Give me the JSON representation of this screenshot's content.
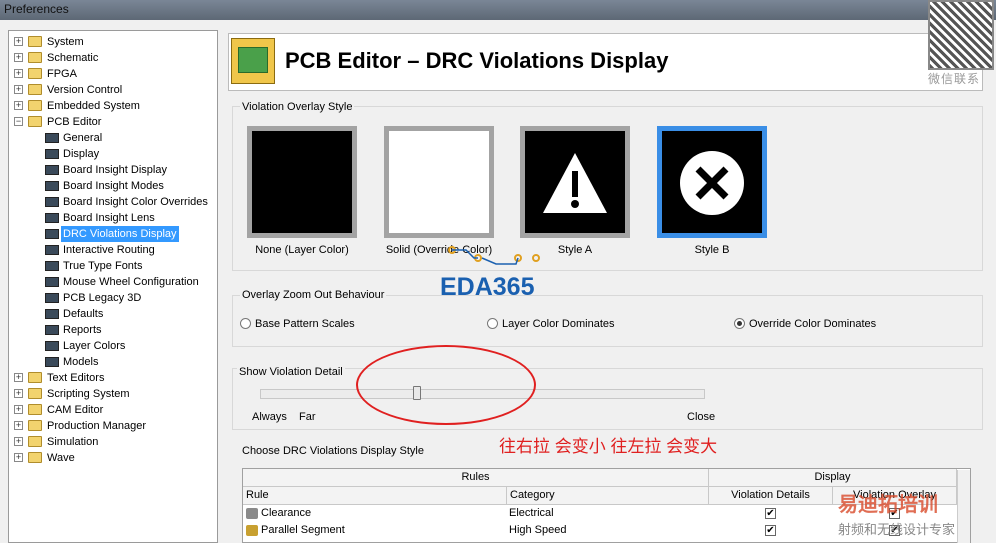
{
  "window": {
    "title": "Preferences"
  },
  "tree": {
    "items": [
      {
        "label": "System",
        "type": "folder",
        "level": 0
      },
      {
        "label": "Schematic",
        "type": "folder",
        "level": 0
      },
      {
        "label": "FPGA",
        "type": "folder",
        "level": 0
      },
      {
        "label": "Version Control",
        "type": "folder",
        "level": 0
      },
      {
        "label": "Embedded System",
        "type": "folder",
        "level": 0
      },
      {
        "label": "PCB Editor",
        "type": "folder-open",
        "level": 0
      },
      {
        "label": "General",
        "type": "page",
        "level": 1
      },
      {
        "label": "Display",
        "type": "page",
        "level": 1
      },
      {
        "label": "Board Insight Display",
        "type": "page",
        "level": 1
      },
      {
        "label": "Board Insight Modes",
        "type": "page",
        "level": 1
      },
      {
        "label": "Board Insight Color Overrides",
        "type": "page",
        "level": 1
      },
      {
        "label": "Board Insight Lens",
        "type": "page",
        "level": 1
      },
      {
        "label": "DRC Violations Display",
        "type": "page",
        "level": 1,
        "selected": true
      },
      {
        "label": "Interactive Routing",
        "type": "page",
        "level": 1
      },
      {
        "label": "True Type Fonts",
        "type": "page",
        "level": 1
      },
      {
        "label": "Mouse Wheel Configuration",
        "type": "page",
        "level": 1
      },
      {
        "label": "PCB Legacy 3D",
        "type": "page",
        "level": 1
      },
      {
        "label": "Defaults",
        "type": "page",
        "level": 1
      },
      {
        "label": "Reports",
        "type": "page",
        "level": 1
      },
      {
        "label": "Layer Colors",
        "type": "page",
        "level": 1
      },
      {
        "label": "Models",
        "type": "page",
        "level": 1
      },
      {
        "label": "Text Editors",
        "type": "folder",
        "level": 0
      },
      {
        "label": "Scripting System",
        "type": "folder",
        "level": 0
      },
      {
        "label": "CAM Editor",
        "type": "folder",
        "level": 0
      },
      {
        "label": "Production Manager",
        "type": "folder",
        "level": 0
      },
      {
        "label": "Simulation",
        "type": "folder",
        "level": 0
      },
      {
        "label": "Wave",
        "type": "folder",
        "level": 0
      }
    ]
  },
  "page": {
    "title": "PCB Editor – DRC Violations Display"
  },
  "overlay_style": {
    "label": "Violation Overlay Style",
    "options": [
      {
        "label": "None (Layer Color)",
        "selected": false
      },
      {
        "label": "Solid (Override Color)",
        "selected": false
      },
      {
        "label": "Style A",
        "selected": false
      },
      {
        "label": "Style B",
        "selected": true
      }
    ]
  },
  "zoom_out": {
    "label": "Overlay Zoom Out Behaviour",
    "options": [
      {
        "label": "Base Pattern Scales",
        "selected": false
      },
      {
        "label": "Layer Color Dominates",
        "selected": false
      },
      {
        "label": "Override Color Dominates",
        "selected": true
      }
    ]
  },
  "detail": {
    "label": "Show Violation Detail",
    "always": "Always",
    "far": "Far",
    "close": "Close",
    "level": 0.35
  },
  "table": {
    "label": "Choose DRC Violations Display Style",
    "group_rules": "Rules",
    "group_display": "Display",
    "col_rule": "Rule",
    "col_category": "Category",
    "col_details": "Violation Details",
    "col_overlay": "Violation Overlay",
    "rows": [
      {
        "rule": "Clearance",
        "category": "Electrical",
        "details": true,
        "overlay": true
      },
      {
        "rule": "Parallel Segment",
        "category": "High Speed",
        "details": true,
        "overlay": true
      }
    ]
  },
  "annotations": {
    "note": "往右拉  会变小  往左拉  会变大",
    "watermark": "EDA365",
    "qr_caption": "微信联系",
    "brand_main": "易迪拓培训",
    "brand_sub": "射频和无线设计专家"
  },
  "colors": {
    "selection": "#3399ff",
    "annotation": "#e02020",
    "selected_swatch": "#3a8ee6"
  }
}
